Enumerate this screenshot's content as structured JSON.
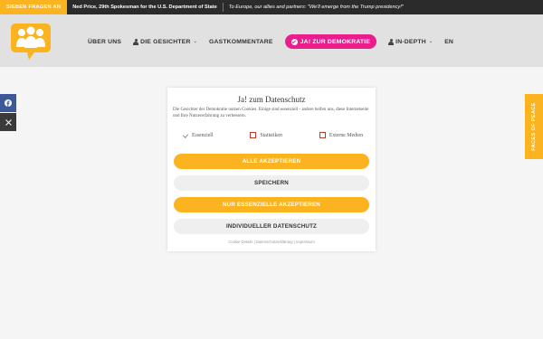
{
  "ticker": {
    "tag": "SIEBEN FRAGEN AN",
    "item1": "Ned Price, 29th Spokesman for the U.S. Department of State",
    "item2": "To Europe, our allies and partners: \"We'll emerge from the Trump presidency!\""
  },
  "nav": {
    "items": [
      {
        "label": "ÜBER UNS"
      },
      {
        "label": "DIE GESICHTER"
      },
      {
        "label": "GASTKOMMENTARE"
      },
      {
        "label": "JA! ZUR DEMOKRATIE"
      },
      {
        "label": "IN-DEPTH"
      },
      {
        "label": "EN"
      }
    ]
  },
  "side_tab": "FACES OF PEACE",
  "cookie": {
    "title": "Ja! zum Datenschutz",
    "text": "Die Gesichter der Demokratie nutzen Cookies. Einige sind essenziell - andere helfen uns, diese Internetseite und Ihre Nutzererfahrung zu verbessern.",
    "checks": [
      "Essenziell",
      "Statistiken",
      "Externe Medien"
    ],
    "accept_all": "ALLE AKZEPTIEREN",
    "save": "SPEICHERN",
    "accept_essential": "NUR ESSENZIELLE AKZEPTIEREN",
    "individual": "INDIVIDUELLER DATENSCHUTZ",
    "links": [
      "Cookie-Details",
      "Datenschutzerklärung",
      "Impressum"
    ]
  },
  "colors": {
    "brand_orange": "#fbb31f",
    "cta_pink": "#e91e8c",
    "facebook_blue": "#3b5998"
  }
}
